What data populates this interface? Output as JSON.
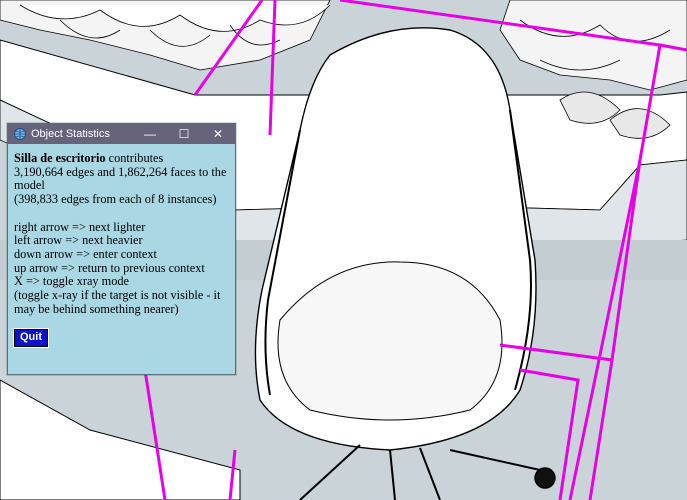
{
  "dialog": {
    "title": "Object Statistics",
    "object_name": "Silla de escritorio",
    "contributes_word": "contributes",
    "stats_line1": "3,190,664 edges and 1,862,264 faces to the",
    "stats_line2": "model",
    "instances_line": "(398,833 edges from each of 8 instances)",
    "instructions": [
      "right arrow => next lighter",
      "left arrow => next heavier",
      "down arrow => enter context",
      "up arrow => return to previous context",
      "X => toggle xray mode",
      "(toggle x-ray if the target is not visible - it",
      "may be behind something nearer)"
    ],
    "quit_label": "Quit",
    "minimize_glyph": "—",
    "maximize_glyph": "☐",
    "close_glyph": "✕"
  },
  "colors": {
    "titlebar": "#66637a",
    "dialog_bg": "#a9d7e3",
    "quit_bg": "#0b12cc",
    "selection_box": "#e600e6",
    "floor": "#c9d3d8"
  },
  "scene": {
    "object": "office-chair",
    "icons": [
      "app-icon",
      "minimize-icon",
      "maximize-icon",
      "close-icon"
    ]
  }
}
